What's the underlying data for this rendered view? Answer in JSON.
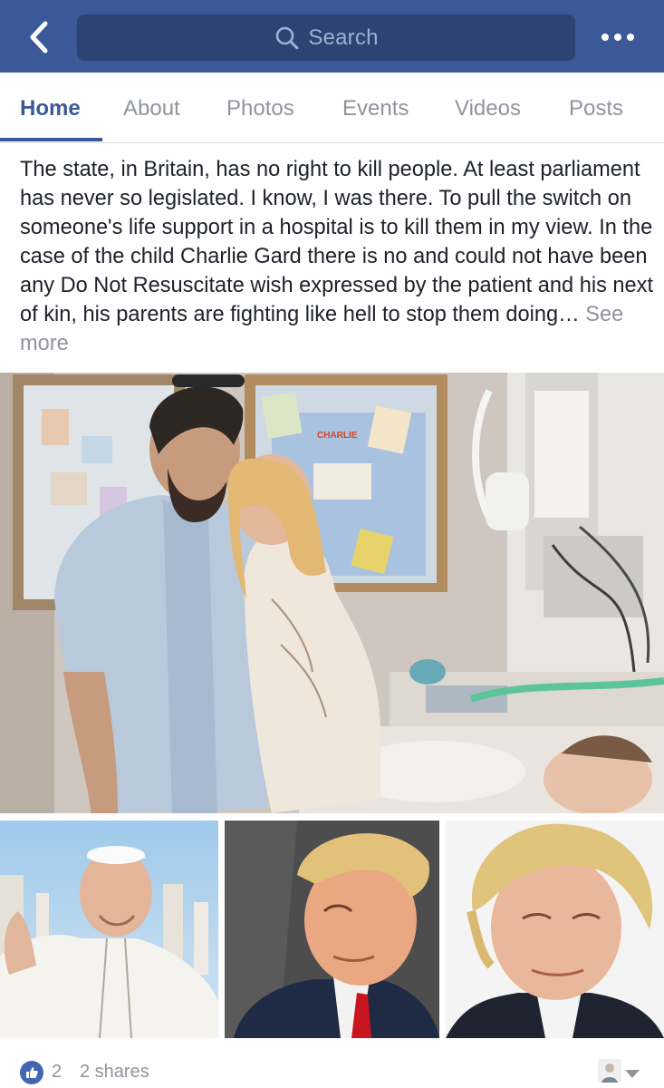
{
  "header": {
    "back_icon": "chevron-left-icon",
    "search_icon": "search-icon",
    "search_placeholder": "Search",
    "more_icon": "more-dots-icon",
    "bar_color": "#3b5998"
  },
  "tabs": [
    {
      "label": "Home",
      "active": true
    },
    {
      "label": "About",
      "active": false
    },
    {
      "label": "Photos",
      "active": false
    },
    {
      "label": "Events",
      "active": false
    },
    {
      "label": "Videos",
      "active": false
    },
    {
      "label": "Posts",
      "active": false
    }
  ],
  "post": {
    "text": "The state, in Britain, has no right to kill people. At least parliament has never so legislated. I know, I was there. To pull the switch on someone's life support in a hospital is to kill them in my view. In the case of the child Charlie Gard there is no and could not have been any Do Not Resuscitate wish expressed by the patient and his next of kin, his parents are fighting like hell to stop them doing…",
    "see_more": "See more",
    "photo_sign_text": "CHARLIE"
  },
  "footer": {
    "like_icon": "thumbs-up-icon",
    "like_count": "2",
    "shares": "2 shares",
    "dropdown_icon": "caret-down-icon"
  },
  "colors": {
    "brand": "#3b5998",
    "muted": "#90949c",
    "text": "#1d2129"
  }
}
